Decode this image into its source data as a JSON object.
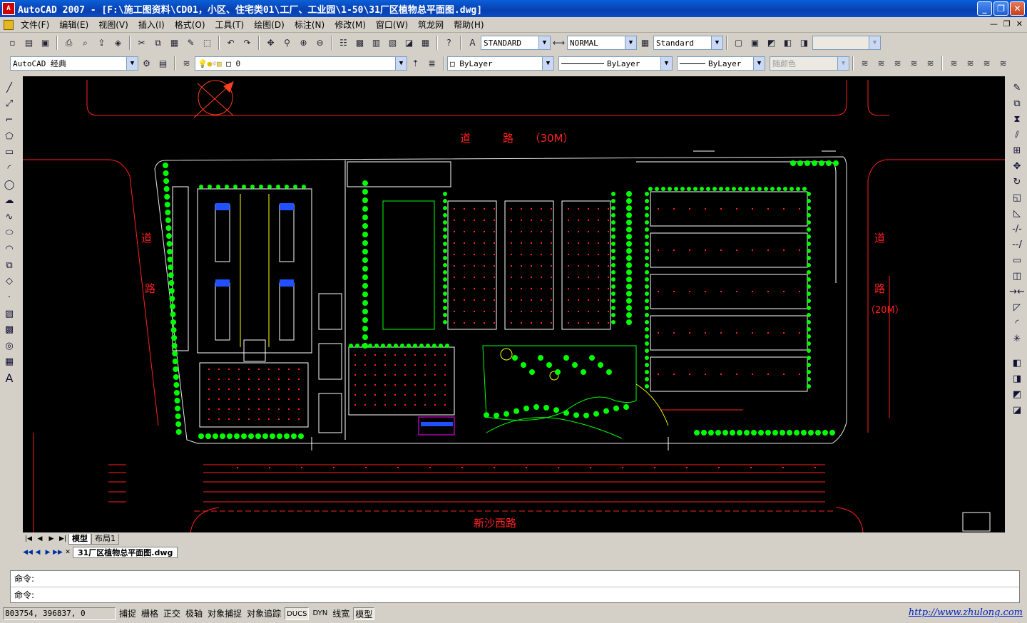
{
  "window": {
    "title": "AutoCAD 2007 - [F:\\施工图资料\\CD01，小区、住宅类01\\工厂、工业园\\1-50\\31厂区植物总平面图.dwg]",
    "logo_text": "A"
  },
  "menu": {
    "items": [
      "文件(F)",
      "编辑(E)",
      "视图(V)",
      "插入(I)",
      "格式(O)",
      "工具(T)",
      "绘图(D)",
      "标注(N)",
      "修改(M)",
      "窗口(W)",
      "筑龙网",
      "帮助(H)"
    ]
  },
  "toolbar": {
    "text_style": "STANDARD",
    "dim_style": "NORMAL",
    "table_style": "Standard",
    "workspace": "AutoCAD 经典",
    "layer": "0",
    "color": "ByLayer",
    "linetype": "ByLayer",
    "lineweight": "ByLayer",
    "plot_style": "随颜色"
  },
  "drawing": {
    "road_top": "道　　　路　　（30M）",
    "road_left_1": "道",
    "road_left_2": "路",
    "road_right_1": "道",
    "road_right_2": "路",
    "road_right_3": "（20M）",
    "road_bottom": "新沙西路",
    "colors": {
      "background": "#000000",
      "road": "#ff2020",
      "tree": "#00ff00",
      "building": "#ffffff",
      "path": "#ffff00"
    }
  },
  "layout_tabs": [
    "模型",
    "布局1"
  ],
  "doc_tab": "31厂区植物总平面图.dwg",
  "command": {
    "line1": "命令:",
    "line2": "命令:"
  },
  "status": {
    "coords": "803754, 396837, 0",
    "buttons": [
      "捕捉",
      "栅格",
      "正交",
      "极轴",
      "对象捕捉",
      "对象追踪",
      "DUCS",
      "DYN",
      "线宽",
      "模型"
    ],
    "link": "http://www.zhulong.com"
  }
}
